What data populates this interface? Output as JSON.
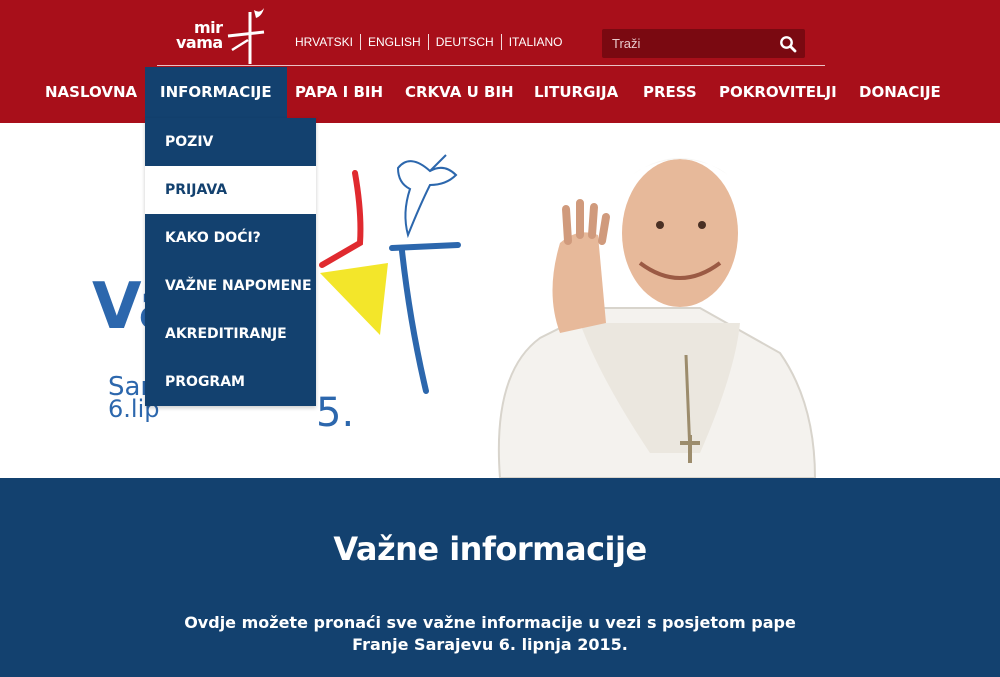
{
  "header": {
    "logo": {
      "line1": "mir",
      "line2": "vama"
    },
    "languages": [
      "HRVATSKI",
      "ENGLISH",
      "DEUTSCH",
      "ITALIANO"
    ],
    "search": {
      "placeholder": "Traži",
      "value": ""
    },
    "nav": [
      {
        "label": "NASLOVNA",
        "active": false
      },
      {
        "label": "INFORMACIJE",
        "active": true
      },
      {
        "label": "PAPA I BIH",
        "active": false
      },
      {
        "label": "CRKVA U BIH",
        "active": false
      },
      {
        "label": "LITURGIJA",
        "active": false
      },
      {
        "label": "PRESS",
        "active": false
      },
      {
        "label": "POKROVITELJI",
        "active": false
      },
      {
        "label": "DONACIJE",
        "active": false
      }
    ]
  },
  "dropdown": {
    "items": [
      {
        "label": "POZIV",
        "hover": false
      },
      {
        "label": "PRIJAVA",
        "hover": true
      },
      {
        "label": "KAKO DOĆI?",
        "hover": false
      },
      {
        "label": "VAŽNE NAPOMENE",
        "hover": false
      },
      {
        "label": "AKREDITIRANJE",
        "hover": false
      },
      {
        "label": "PROGRAM",
        "hover": false
      }
    ]
  },
  "hero": {
    "banner_partial_text": {
      "big": "Va",
      "line1": "Sar",
      "line2": "6.lip",
      "tail": "5."
    }
  },
  "info": {
    "title": "Važne informacije",
    "text": "Ovdje možete pronaći sve važne informacije u vezi s posjetom pape Franje Sarajevu 6. lipnja 2015."
  },
  "colors": {
    "header_red": "#a80f1a",
    "navy": "#13416f",
    "search_bg": "#7a0911",
    "logo_blue": "#2c67ad",
    "logo_red": "#e02a2f",
    "logo_yellow": "#f3e62a"
  }
}
